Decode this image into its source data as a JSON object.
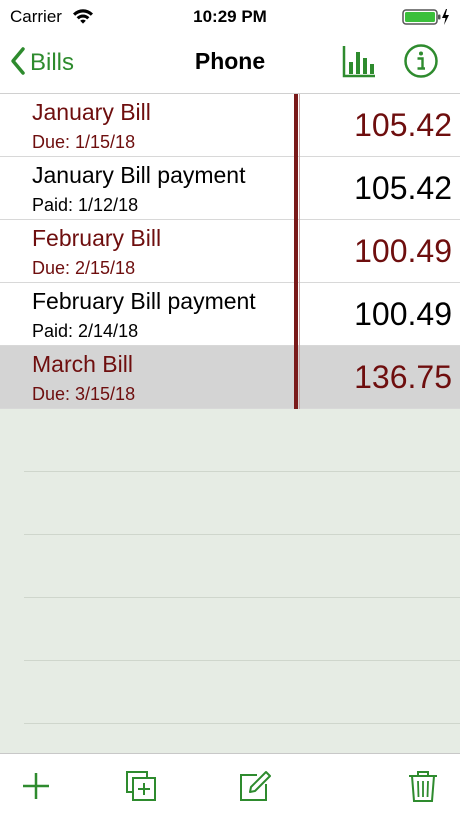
{
  "status": {
    "carrier": "Carrier",
    "time": "10:29 PM"
  },
  "nav": {
    "back_label": "Bills",
    "title": "Phone"
  },
  "colors": {
    "accent": "#2e8b2e",
    "bill_text": "#6e0e0e",
    "divider": "#7a1a1a",
    "empty_area": "#e6ece4"
  },
  "rows": [
    {
      "title": "January Bill",
      "sub": "Due: 1/15/18",
      "amount": "105.42",
      "kind": "bill"
    },
    {
      "title": "January Bill payment",
      "sub": "Paid: 1/12/18",
      "amount": "105.42",
      "kind": "payment"
    },
    {
      "title": "February Bill",
      "sub": "Due: 2/15/18",
      "amount": "100.49",
      "kind": "bill"
    },
    {
      "title": "February Bill payment",
      "sub": "Paid: 2/14/18",
      "amount": "100.49",
      "kind": "payment"
    },
    {
      "title": "March Bill",
      "sub": "Due: 3/15/18",
      "amount": "136.75",
      "kind": "bill",
      "selected": true
    }
  ],
  "toolbar": {
    "icons": [
      "add-icon",
      "duplicate-icon",
      "edit-icon",
      "trash-icon"
    ]
  }
}
